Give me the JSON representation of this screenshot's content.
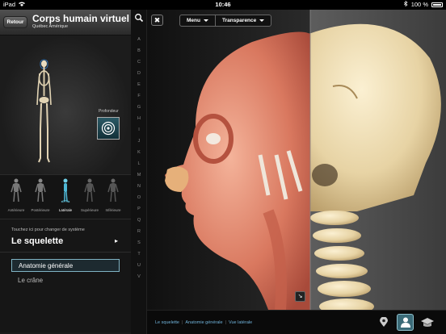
{
  "status": {
    "device": "iPad",
    "time": "10:46",
    "battery": "100 %"
  },
  "header": {
    "back_label": "Retour",
    "title": "Corps humain virtuel",
    "subtitle": "Québec Amérique"
  },
  "depth": {
    "label": "Profondeur"
  },
  "views": [
    {
      "label": "Antérieure",
      "active": false
    },
    {
      "label": "Postérieure",
      "active": false
    },
    {
      "label": "Latérale",
      "active": true
    },
    {
      "label": "Supérieure",
      "active": false
    },
    {
      "label": "Inférieure",
      "active": false
    }
  ],
  "system": {
    "hint": "Touchez ici pour changer de système",
    "name": "Le squelette",
    "items": [
      {
        "label": "Anatomie générale",
        "selected": true
      },
      {
        "label": "Le crâne",
        "selected": false
      }
    ]
  },
  "alphabet": [
    "A",
    "B",
    "C",
    "D",
    "E",
    "F",
    "G",
    "H",
    "I",
    "J",
    "K",
    "L",
    "M",
    "N",
    "O",
    "P",
    "Q",
    "R",
    "S",
    "T",
    "U",
    "V"
  ],
  "toolbar": {
    "menu_label": "Menu",
    "transparency_label": "Transparence"
  },
  "breadcrumb": {
    "items": [
      "Le squelette",
      "Anatomie générale",
      "Vue latérale"
    ]
  },
  "colors": {
    "accent": "#6fb1d8",
    "selection_border": "#7fb3c4",
    "active_button": "#3b6b78"
  }
}
